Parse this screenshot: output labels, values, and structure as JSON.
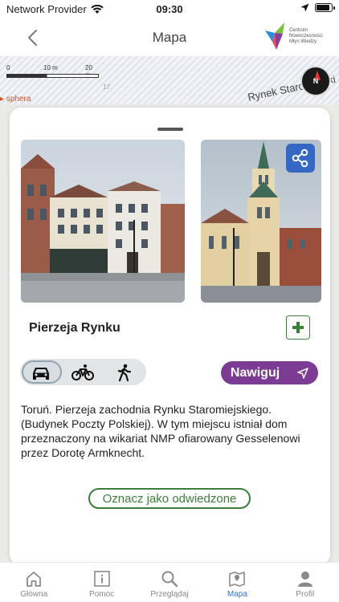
{
  "status": {
    "carrier": "Network Provider",
    "time": "09:30",
    "battery_level": 0.9
  },
  "nav": {
    "title": "Mapa",
    "logo_text": [
      "Centrum",
      "Nowoczesności",
      "Młyn Wiedzy"
    ]
  },
  "map": {
    "scale_labels": [
      "0",
      "10 m",
      "20 m"
    ],
    "poi_label": "sphera",
    "street_label": "Rynek Staromiejski",
    "block_number": "17",
    "compass_label": "N"
  },
  "place": {
    "name": "Pierzeja Rynku",
    "description": "Toruń. Pierzeja zachodnia Rynku Staromiejskiego. (Budynek Poczty Polskiej). W tym miejscu istniał dom przeznaczony na wikariat NMP ofiarowany Gesselenowi przez Dorotę Armknecht.",
    "navigate_label": "Nawiguj",
    "visited_label": "Oznacz jako odwiedzone",
    "active_mode": "car",
    "modes": [
      "car",
      "bike",
      "walk"
    ]
  },
  "tabs": [
    {
      "label": "Główna",
      "icon": "home-icon"
    },
    {
      "label": "Pomoc",
      "icon": "info-icon"
    },
    {
      "label": "Przeglądaj",
      "icon": "search-icon"
    },
    {
      "label": "Mapa",
      "icon": "map-icon",
      "active": true
    },
    {
      "label": "Profil",
      "icon": "profile-icon"
    }
  ],
  "colors": {
    "accent_purple": "#7c3c93",
    "accent_green": "#3c7d3a",
    "share_blue": "#3468c4",
    "tab_active": "#2d6fd6"
  }
}
